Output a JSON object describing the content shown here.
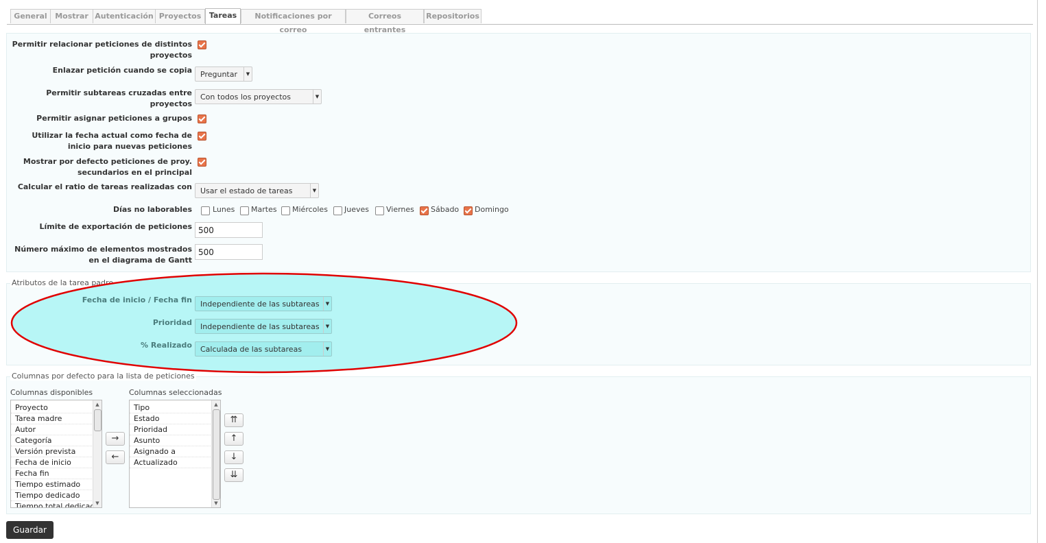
{
  "tabs": [
    "General",
    "Mostrar",
    "Autenticación",
    "Proyectos",
    "Tareas",
    "Notificaciones por correo",
    "Correos entrantes",
    "Repositorios"
  ],
  "settings": {
    "cross_project_relations": {
      "label": "Permitir relacionar peticiones de distintos proyectos",
      "checked": true
    },
    "link_copied": {
      "label": "Enlazar petición cuando se copia",
      "value": "Preguntar"
    },
    "cross_project_subtasks": {
      "label": "Permitir subtareas cruzadas entre proyectos",
      "value": "Con todos los proyectos"
    },
    "group_assignment": {
      "label": "Permitir asignar peticiones a grupos",
      "checked": true
    },
    "default_start_date": {
      "label": "Utilizar la fecha actual como fecha de inicio para nuevas peticiones",
      "checked": true
    },
    "display_subprojects": {
      "label": "Mostrar por defecto peticiones de proy. secundarios en el principal",
      "checked": true
    },
    "done_ratio": {
      "label": "Calcular el ratio de tareas realizadas con",
      "value": "Usar el estado de tareas"
    },
    "non_working_days": {
      "label": "Días no laborables",
      "days": [
        {
          "name": "Lunes",
          "checked": false
        },
        {
          "name": "Martes",
          "checked": false
        },
        {
          "name": "Miércoles",
          "checked": false
        },
        {
          "name": "Jueves",
          "checked": false
        },
        {
          "name": "Viernes",
          "checked": false
        },
        {
          "name": "Sábado",
          "checked": true
        },
        {
          "name": "Domingo",
          "checked": true
        }
      ]
    },
    "export_limit": {
      "label": "Límite de exportación de peticiones",
      "value": "500"
    },
    "gantt_limit": {
      "label": "Número máximo de elementos mostrados en el diagrama de Gantt",
      "value": "500"
    }
  },
  "parent_attrs": {
    "legend": "Atributos de la tarea padre",
    "dates": {
      "label": "Fecha de inicio / Fecha fin",
      "value": "Independiente de las subtareas"
    },
    "priority": {
      "label": "Prioridad",
      "value": "Independiente de las subtareas"
    },
    "done_ratio": {
      "label": "% Realizado",
      "value": "Calculada de las subtareas"
    }
  },
  "columns": {
    "legend": "Columnas por defecto para la lista de peticiones",
    "available_label": "Columnas disponibles",
    "selected_label": "Columnas seleccionadas",
    "available": [
      "Proyecto",
      "Tarea madre",
      "Autor",
      "Categoría",
      "Versión prevista",
      "Fecha de inicio",
      "Fecha fin",
      "Tiempo estimado",
      "Tiempo dedicado",
      "Tiempo total dedicado"
    ],
    "selected": [
      "Tipo",
      "Estado",
      "Prioridad",
      "Asunto",
      "Asignado a",
      "Actualizado"
    ],
    "add_label": "→",
    "remove_label": "←",
    "top_label": "⇈",
    "up_label": "↑",
    "down_label": "↓",
    "bottom_label": "⇊"
  },
  "save_label": "Guardar",
  "colors": {
    "highlight_ellipse": "#e00000",
    "checkbox_on": "#e8744a",
    "select_highlight": "#a2eeee"
  }
}
